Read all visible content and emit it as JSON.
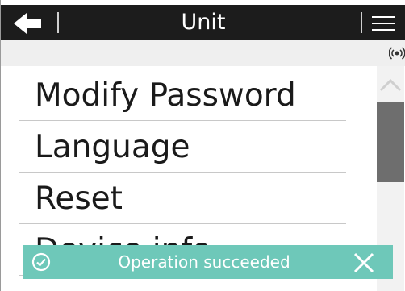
{
  "header": {
    "title": "Unit",
    "back_icon": "arrow-left-icon",
    "menu_icon": "hamburger-menu-icon"
  },
  "status": {
    "indicator_icon": "wireless-signal-icon"
  },
  "menu": {
    "items": [
      {
        "label": "Modify Password"
      },
      {
        "label": "Language"
      },
      {
        "label": "Reset"
      },
      {
        "label": "Device info"
      }
    ]
  },
  "toast": {
    "message": "Operation succeeded",
    "icon": "check-circle-icon",
    "close_icon": "close-icon",
    "color": "#6ec8b9"
  },
  "colors": {
    "header_bg": "#1c1c1c",
    "status_bg": "#efefef"
  }
}
